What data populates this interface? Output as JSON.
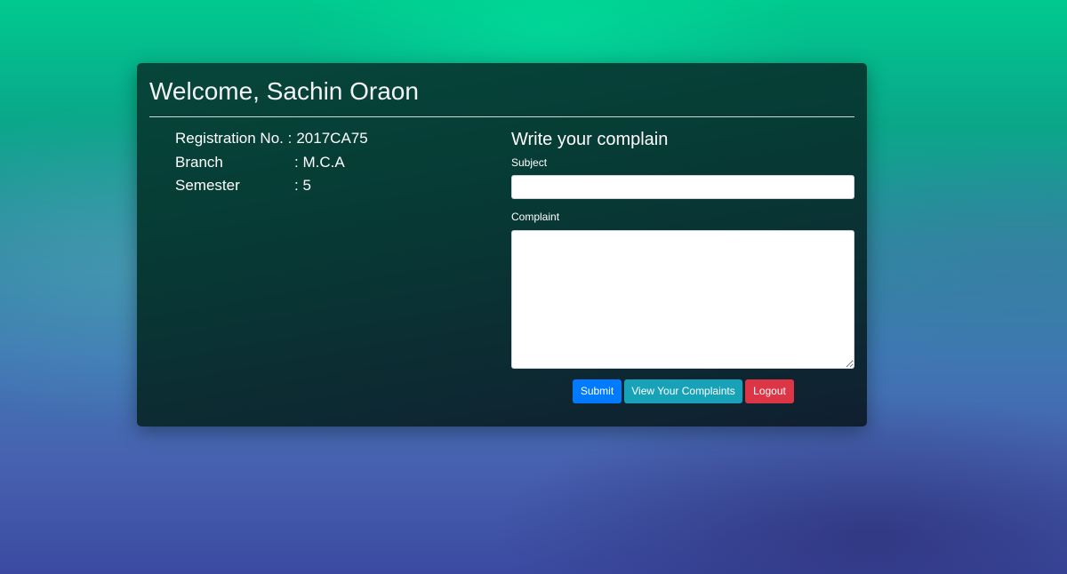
{
  "header": {
    "welcome": "Welcome, Sachin Oraon"
  },
  "student": {
    "registration_label": "Registration No. :",
    "registration_value": "2017CA75",
    "branch_label": "Branch",
    "branch_value": ": M.C.A",
    "semester_label": "Semester",
    "semester_value": ": 5"
  },
  "form": {
    "title": "Write your complain",
    "subject_label": "Subject",
    "subject_value": "",
    "complaint_label": "Complaint",
    "complaint_value": ""
  },
  "buttons": {
    "submit": "Submit",
    "view_complaints": "View Your Complaints",
    "logout": "Logout"
  },
  "colors": {
    "submit": "#007bff",
    "view_complaints": "#17a2b8",
    "logout": "#dc3545"
  }
}
